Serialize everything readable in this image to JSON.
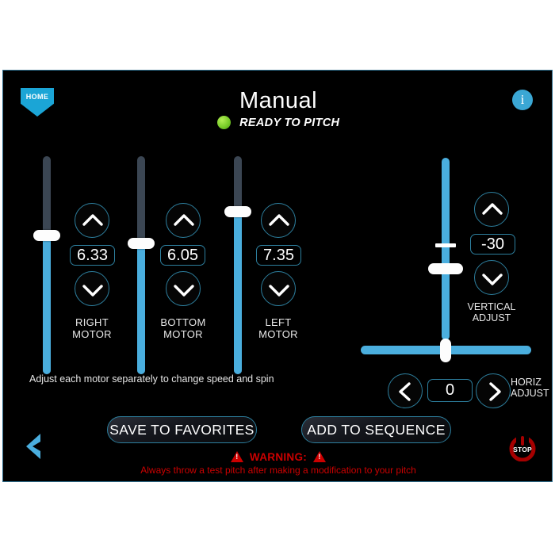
{
  "header": {
    "home_label": "HOME",
    "info_label": "i",
    "title": "Manual",
    "status_text": "READY TO PITCH",
    "status_color": "#7ed321"
  },
  "theme": {
    "accent": "#4aaede",
    "track_inactive": "#3b4653",
    "border": "#2d7f9e",
    "warning": "#cc0000",
    "background": "#000000"
  },
  "motors": [
    {
      "name": "right-motor",
      "value": "6.33",
      "label_line1": "RIGHT",
      "label_line2": "MOTOR"
    },
    {
      "name": "bottom-motor",
      "value": "6.05",
      "label_line1": "BOTTOM",
      "label_line2": "MOTOR"
    },
    {
      "name": "left-motor",
      "value": "7.35",
      "label_line1": "LEFT",
      "label_line2": "MOTOR"
    }
  ],
  "hint": "Adjust each motor separately to change speed and spin",
  "vertical_adjust": {
    "value": "-30",
    "label_line1": "VERTICAL",
    "label_line2": "ADJUST"
  },
  "horizontal_adjust": {
    "value": "0",
    "label_line1": "HORIZ",
    "label_line2": "ADJUST"
  },
  "actions": {
    "save_to_favorites": "SAVE TO FAVORITES",
    "add_to_sequence": "ADD TO SEQUENCE",
    "stop_label": "STOP"
  },
  "warning": {
    "title": "WARNING:",
    "message": "Always throw a test pitch after making a modification to your pitch"
  }
}
